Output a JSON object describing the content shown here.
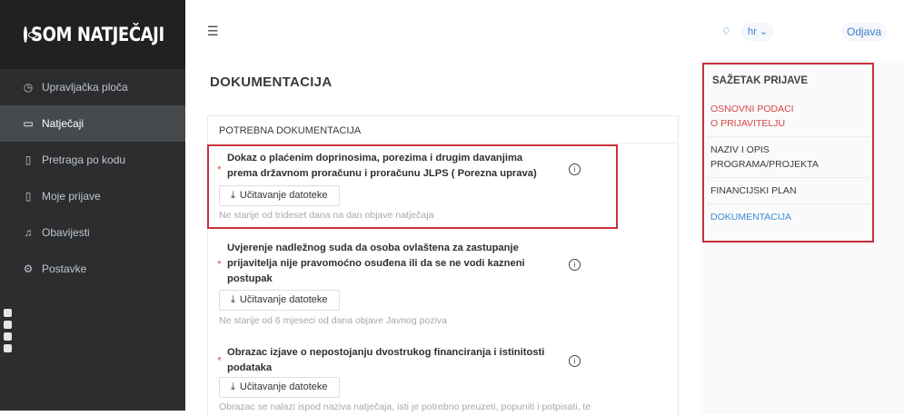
{
  "brand": {
    "name": "SOM NATJEČAJI",
    "icon": "eye-logo-icon"
  },
  "sidebar": {
    "items": [
      {
        "label": "Upravljačka ploča",
        "icon": "dashboard-icon",
        "active": false
      },
      {
        "label": "Natječaji",
        "icon": "folder-icon",
        "active": true
      },
      {
        "label": "Pretraga po kodu",
        "icon": "document-icon",
        "active": false
      },
      {
        "label": "Moje prijave",
        "icon": "file-icon",
        "active": false
      },
      {
        "label": "Obavijesti",
        "icon": "bell-icon",
        "active": false
      },
      {
        "label": "Postavke",
        "icon": "gear-icon",
        "active": false
      }
    ]
  },
  "topbar": {
    "language": "hr",
    "logout": "Odjava"
  },
  "page": {
    "title": "DOKUMENTACIJA"
  },
  "documentation": {
    "header": "POTREBNA DOKUMENTACIJA",
    "upload_label": "Učitavanje datoteke",
    "items": [
      {
        "title_lines": [
          "Dokaz o plaćenim doprinosima, porezima i drugim davanjima",
          "prema državnom proračunu i proračunu JLPS ( Porezna uprava)"
        ],
        "hint": "Ne starije od trideset dana na dan objave natječaja"
      },
      {
        "title_lines": [
          "Uvjerenje nadležnog suda da osoba ovlaštena za zastupanje",
          "prijavitelja nije pravomoćno osuđena ili da se ne vodi kazneni",
          "postupak"
        ],
        "hint": "Ne starije od 6 mjeseci od dana objave Javnog poziva"
      },
      {
        "title_lines": [
          "Obrazac izjave o nepostojanju dvostrukog financiranja i istinitosti",
          "podataka"
        ],
        "hint": "Obrazac se nalazi ispod naziva natječaja, isti je potrebno preuzeti, popuniti i potpisati, te"
      }
    ]
  },
  "summary": {
    "title": "SAŽETAK PRIJAVE",
    "items": [
      {
        "lines": [
          "OSNOVNI PODACI",
          "O PRIJAVITELJU"
        ],
        "state": "red"
      },
      {
        "lines": [
          "NAZIV I OPIS",
          "PROGRAMA/PROJEKTA"
        ],
        "state": "normal"
      },
      {
        "lines": [
          "FINANCIJSKI PLAN"
        ],
        "state": "normal"
      },
      {
        "lines": [
          "DOKUMENTACIJA"
        ],
        "state": "blue"
      }
    ]
  },
  "colors": {
    "sidebar": "#2b2d2f",
    "accent": "#3a8bd6",
    "highlight": "#c8313b",
    "required": "#e05252"
  }
}
